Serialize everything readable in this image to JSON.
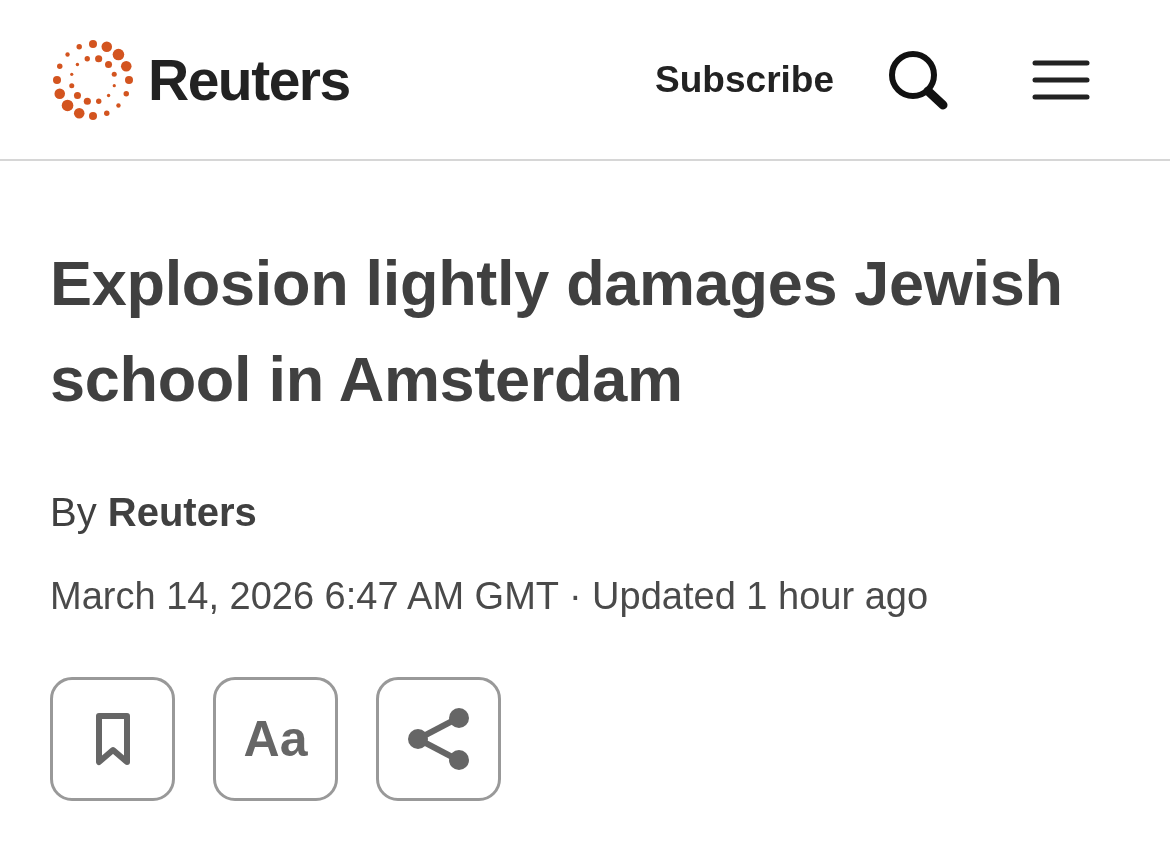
{
  "header": {
    "logo_text": "Reuters",
    "subscribe": "Subscribe"
  },
  "article": {
    "headline": "Explosion lightly damages Jewish school in Amsterdam",
    "byline": "By **Reuters**",
    "dateline": "March 14, 2026 6:47 AM GMT · Updated 1 hour ago"
  },
  "toolbar": [
    {
      "kind": "bookmark"
    },
    {
      "kind": "text-size",
      "label": "Aa"
    },
    {
      "kind": "share"
    }
  ]
}
